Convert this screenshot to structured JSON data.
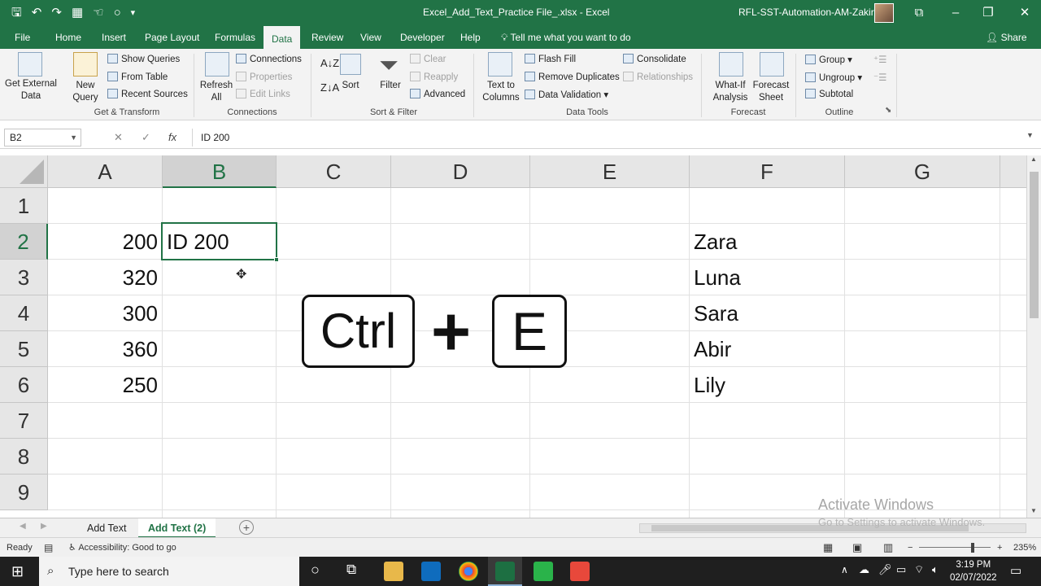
{
  "window": {
    "title": "Excel_Add_Text_Practice File_.xlsx  -  Excel",
    "account": "RFL-SST-Automation-AM-Zakir"
  },
  "menu": {
    "tabs": [
      "File",
      "Home",
      "Insert",
      "Page Layout",
      "Formulas",
      "Data",
      "Review",
      "View",
      "Developer",
      "Help"
    ],
    "active": "Data",
    "tell_me": "Tell me what you want to do",
    "share": "Share"
  },
  "ribbon": {
    "get_external": "Get External Data",
    "new_query": "New Query",
    "show_queries": "Show Queries",
    "from_table": "From Table",
    "recent_sources": "Recent Sources",
    "group_get_transform": "Get & Transform",
    "refresh_all": "Refresh All",
    "connections": "Connections",
    "properties": "Properties",
    "edit_links": "Edit Links",
    "group_connections": "Connections",
    "sort": "Sort",
    "filter": "Filter",
    "clear": "Clear",
    "reapply": "Reapply",
    "advanced": "Advanced",
    "group_sort_filter": "Sort & Filter",
    "text_to_columns": "Text to Columns",
    "flash_fill": "Flash Fill",
    "remove_duplicates": "Remove Duplicates",
    "data_validation": "Data Validation",
    "consolidate": "Consolidate",
    "relationships": "Relationships",
    "group_data_tools": "Data Tools",
    "what_if": "What-If Analysis",
    "forecast_sheet": "Forecast Sheet",
    "group_forecast": "Forecast",
    "group_btn": "Group",
    "ungroup": "Ungroup",
    "subtotal": "Subtotal",
    "group_outline": "Outline"
  },
  "formula_bar": {
    "name_box": "B2",
    "formula": "ID 200",
    "cancel": "✕",
    "enter": "✓",
    "fx": "fx"
  },
  "sheet": {
    "columns": [
      "A",
      "B",
      "C",
      "D",
      "E",
      "F",
      "G"
    ],
    "rows": [
      "1",
      "2",
      "3",
      "4",
      "5",
      "6",
      "7",
      "8",
      "9"
    ],
    "a_values": [
      "200",
      "320",
      "300",
      "360",
      "250"
    ],
    "b2": "ID 200",
    "f_values": [
      "Zara",
      "Luna",
      "Sara",
      "Abir",
      "Lily"
    ]
  },
  "overlay": {
    "key1": "Ctrl",
    "plus": "+",
    "key2": "E"
  },
  "sheet_tabs": [
    "Add Text",
    "Add Text (2)"
  ],
  "active_sheet": "Add Text (2)",
  "status": {
    "ready": "Ready",
    "accessibility": "Accessibility: Good to go",
    "zoom": "235%"
  },
  "watermark": {
    "line1": "Activate Windows",
    "line2": "Go to Settings to activate Windows."
  },
  "taskbar": {
    "search_placeholder": "Type here to search",
    "time": "3:19 PM",
    "date": "02/07/2022"
  },
  "colors": {
    "excel_green": "#217346",
    "ribbon_bg": "#f3f3f3"
  }
}
